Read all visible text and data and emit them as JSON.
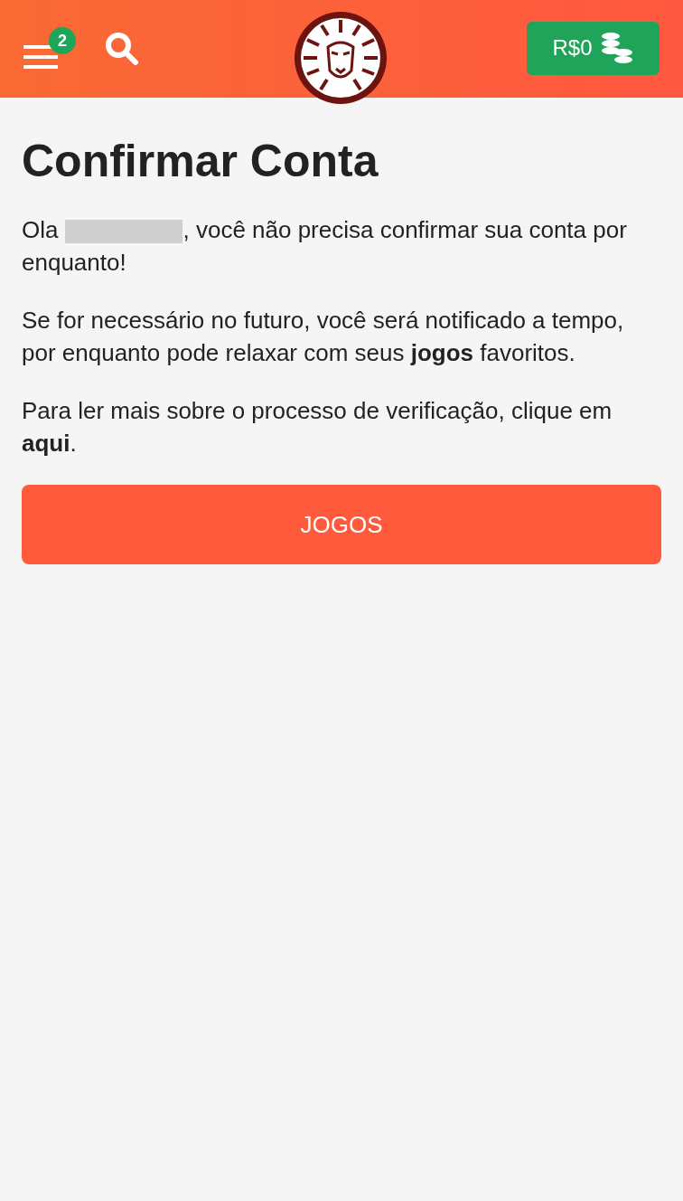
{
  "header": {
    "menu_badge": "2",
    "balance": "R$0"
  },
  "title": "Confirmar Conta",
  "greeting": {
    "before": "Ola",
    "name_redacted": true,
    "after": ", você não precisa confirmar sua conta por enquanto!"
  },
  "paragraph": "Se for necessário no futuro, você será notificado a tempo, por enquanto pode relaxar com seus **jogos** favoritos.",
  "info": {
    "before": "Para ler mais sobre o processo de verificação, clique em ",
    "link": "aqui",
    "after": "."
  },
  "button": "JOGOS"
}
